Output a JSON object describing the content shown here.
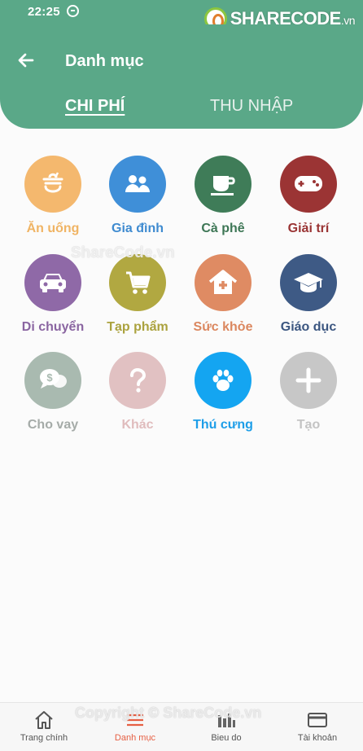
{
  "status_bar": {
    "time": "22:25"
  },
  "watermark": {
    "logo_name": "SHARECODE",
    "logo_suffix": ".vn",
    "text": "ShareCode.vn",
    "copyright": "Copyright © ShareCode.vn"
  },
  "header": {
    "title": "Danh mục",
    "back_icon": "arrow-left-icon"
  },
  "tabs": [
    {
      "label": "CHI PHÍ",
      "active": true
    },
    {
      "label": "THU NHẬP",
      "active": false
    }
  ],
  "categories": [
    {
      "label": "Ăn uống",
      "icon": "food-icon",
      "color": "#f4b86e",
      "label_color": "#f0b464"
    },
    {
      "label": "Gia đình",
      "icon": "family-icon",
      "color": "#3f8fd8",
      "label_color": "#3f8bd0"
    },
    {
      "label": "Cà phê",
      "icon": "coffee-icon",
      "color": "#3f7c58",
      "label_color": "#3d7655"
    },
    {
      "label": "Giải trí",
      "icon": "gamepad-icon",
      "color": "#9b3434",
      "label_color": "#9a3434"
    },
    {
      "label": "Di chuyển",
      "icon": "car-icon",
      "color": "#8f69a7",
      "label_color": "#8a65a1"
    },
    {
      "label": "Tạp phẩm",
      "icon": "cart-icon",
      "color": "#b1a841",
      "label_color": "#aba23e"
    },
    {
      "label": "Sức khỏe",
      "icon": "health-icon",
      "color": "#df8b63",
      "label_color": "#db875f"
    },
    {
      "label": "Giáo dục",
      "icon": "graduation-icon",
      "color": "#3e5a85",
      "label_color": "#3b5680"
    },
    {
      "label": "Cho vay",
      "icon": "loan-icon",
      "color": "#a9bab0",
      "label_color": "#a5aba8"
    },
    {
      "label": "Khác",
      "icon": "question-icon",
      "color": "#e1c1c2",
      "label_color": "#e0bcbd"
    },
    {
      "label": "Thú cưng",
      "icon": "paw-icon",
      "color": "#14a5f1",
      "label_color": "#1d9ee8"
    },
    {
      "label": "Tạo",
      "icon": "plus-icon",
      "color": "#c7c7c7",
      "label_color": "#c4c4c4"
    }
  ],
  "bottom_nav": [
    {
      "label": "Trang chính",
      "icon": "home-icon",
      "active": false
    },
    {
      "label": "Danh mục",
      "icon": "list-icon",
      "active": true
    },
    {
      "label": "Bieu do",
      "icon": "bar-chart-icon",
      "active": false
    },
    {
      "label": "Tài khoản",
      "icon": "card-icon",
      "active": false
    }
  ]
}
